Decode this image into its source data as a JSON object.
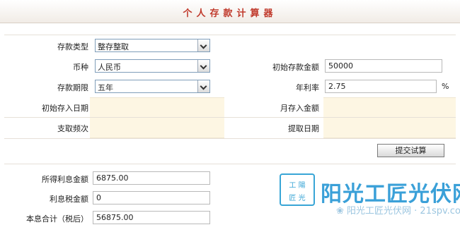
{
  "title": "个人存款计算器",
  "form": {
    "deposit_type": {
      "label": "存款类型",
      "value": "整存整取"
    },
    "currency": {
      "label": "币种",
      "value": "人民币"
    },
    "term": {
      "label": "存款期限",
      "value": "五年"
    },
    "initial_amount": {
      "label": "初始存款金额",
      "value": "50000"
    },
    "annual_rate": {
      "label": "年利率",
      "value": "2.75",
      "unit": "%"
    },
    "initial_date": {
      "label": "初始存入日期",
      "value": ""
    },
    "monthly_amount": {
      "label": "月存入金额",
      "value": ""
    },
    "withdraw_freq": {
      "label": "支取频次",
      "value": ""
    },
    "withdraw_date": {
      "label": "提取日期",
      "value": ""
    }
  },
  "submit_label": "提交试算",
  "results": {
    "interest": {
      "label": "所得利息金额",
      "value": "6875.00"
    },
    "tax": {
      "label": "利息税金额",
      "value": "0"
    },
    "total": {
      "label": "本息合计（税后）",
      "value": "56875.00"
    }
  },
  "watermark": {
    "badge_top": "工 陽",
    "badge_bottom": "匠 光",
    "name": "阳光工匠光伏网",
    "url": "❀ 阳光工匠光伏网 · 21spv.com"
  },
  "colors": {
    "title": "#c0392b",
    "highlight_band": "#fdf6e3",
    "watermark": "#3aa0d8"
  }
}
